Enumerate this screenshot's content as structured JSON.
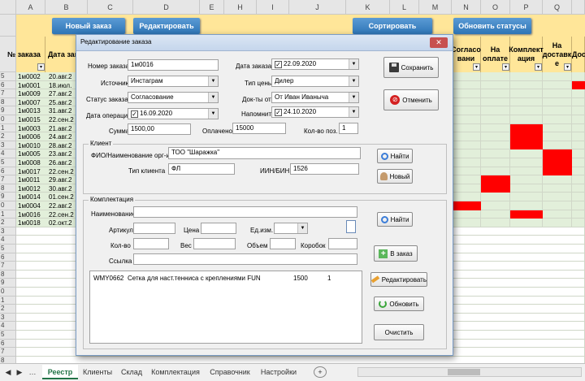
{
  "columns": [
    "A",
    "B",
    "C",
    "D",
    "E",
    "H",
    "I",
    "J",
    "K",
    "L",
    "M",
    "N",
    "O",
    "P",
    "Q"
  ],
  "toolbar": {
    "new_order": "Новый заказ",
    "edit": "Редактировать",
    "sort": "Сортировать",
    "update_statuses": "Обновить статусы"
  },
  "headers": {
    "order_no": "№ заказа",
    "order_date": "Дата заказ",
    "agreed": "Согласо вани",
    "paid": "На оплате",
    "assembled": "Комплект ация",
    "delivery": "На доставк е",
    "delivered": "Дос"
  },
  "rows": [
    {
      "n": "5",
      "order": "1м0002",
      "date": "20.авг.2"
    },
    {
      "n": "6",
      "order": "1м0001",
      "date": "18.июл."
    },
    {
      "n": "7",
      "order": "1м0009",
      "date": "27.авг.2"
    },
    {
      "n": "8",
      "order": "1м0007",
      "date": "25.авг.2"
    },
    {
      "n": "9",
      "order": "1м0013",
      "date": "31.авг.2"
    },
    {
      "n": "0",
      "order": "1м0015",
      "date": "22.сен.2"
    },
    {
      "n": "1",
      "order": "1м0003",
      "date": "21.авг.2"
    },
    {
      "n": "2",
      "order": "1м0006",
      "date": "24.авг.2"
    },
    {
      "n": "3",
      "order": "1м0010",
      "date": "28.авг.2"
    },
    {
      "n": "4",
      "order": "1м0005",
      "date": "23.авг.2"
    },
    {
      "n": "5",
      "order": "1м0008",
      "date": "26.авг.2"
    },
    {
      "n": "6",
      "order": "1м0017",
      "date": "22.сен.2"
    },
    {
      "n": "7",
      "order": "1м0011",
      "date": "29.авг.2"
    },
    {
      "n": "8",
      "order": "1м0012",
      "date": "30.авг.2"
    },
    {
      "n": "9",
      "order": "1м0014",
      "date": "01.сен.2"
    },
    {
      "n": "0",
      "order": "1м0004",
      "date": "22.авг.2"
    },
    {
      "n": "1",
      "order": "1м0016",
      "date": "22.сен.2"
    },
    {
      "n": "2",
      "order": "1м0018",
      "date": "02.окт.2"
    }
  ],
  "empty_rows": [
    "3",
    "4",
    "5",
    "6",
    "7",
    "8",
    "9",
    "0",
    "1",
    "2",
    "3",
    "4",
    "5",
    "6",
    "7",
    "8"
  ],
  "dialog": {
    "title": "Редактирование заказа",
    "close": "✕",
    "labels": {
      "order_no": "Номер заказа",
      "source": "Источник",
      "status": "Статус заказа",
      "op_date": "Дата операции",
      "sum": "Сумма",
      "order_date": "Дата заказа",
      "price_type": "Тип цены",
      "docs_from": "Док-ты от",
      "remind": "Напомнить",
      "paid": "Оплачено",
      "qty_pos": "Кол-во поз."
    },
    "values": {
      "order_no": "1м0016",
      "source": "Инстаграм",
      "status": "Согласование",
      "op_date": "16.09.2020",
      "sum": "1500,00",
      "order_date": "22.09.2020",
      "price_type": "Дилер",
      "docs_from": "От Иван Иваныча",
      "remind": "24.10.2020",
      "paid": "15000",
      "qty_pos": "1"
    },
    "buttons": {
      "save": "Сохранить",
      "cancel": "Отменить",
      "find": "Найти",
      "new": "Новый",
      "find2": "Найти",
      "to_order": "В заказ",
      "edit": "Редактировать",
      "refresh": "Обновить",
      "clear": "Очистить"
    },
    "client": {
      "title": "Клиент",
      "name_label": "ФИО/Наименование орг-и",
      "name": "ТОО \"Шаражка\"",
      "type_label": "Тип клиента",
      "type": "ФЛ",
      "inn_label": "ИИН/БИН",
      "inn": "1526"
    },
    "kit": {
      "title": "Комплектация",
      "name_label": "Наименование",
      "article_label": "Артикул",
      "price_label": "Цена",
      "unit_label": "Ед.изм.",
      "qty_label": "Кол-во",
      "weight_label": "Вес",
      "volume_label": "Объем",
      "box_label": "Коробок",
      "link_label": "Ссылка"
    },
    "items": [
      {
        "code": "WMY0662",
        "name": "Сетка для наст.тенниса с креплениями FUN",
        "price": "1500",
        "qty": "1"
      }
    ]
  },
  "sheet_tabs": [
    "Реестр",
    "Клиенты",
    "Склад",
    "Комплектация",
    "Справочник",
    "Настройки"
  ],
  "add_sheet": "+",
  "red_color": "#ff0000",
  "green_color": "#e2efda"
}
